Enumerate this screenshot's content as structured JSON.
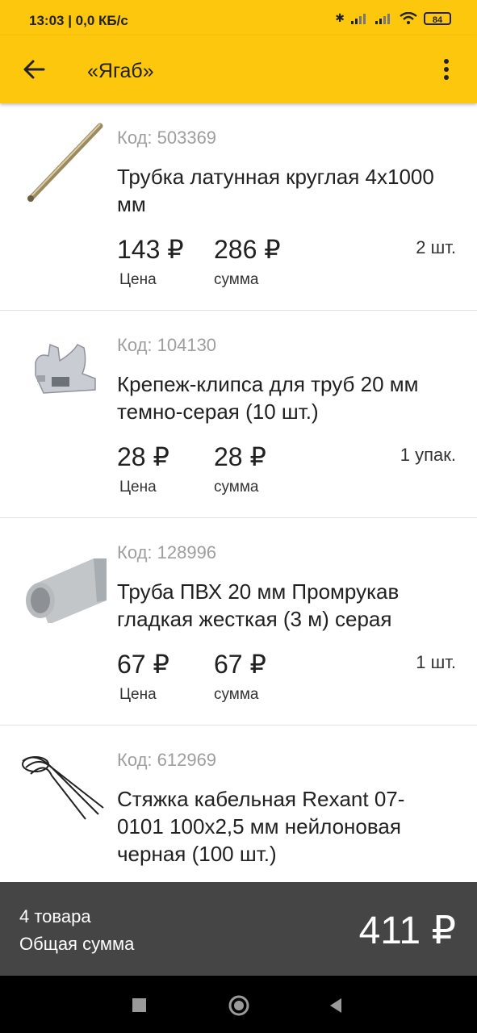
{
  "status": {
    "time": "13:03 | 0,0 КБ/с",
    "battery": "84"
  },
  "toolbar": {
    "title": "«Ягаб»"
  },
  "items": [
    {
      "code": "Код: 503369",
      "name": "Трубка латунная круглая 4х1000 мм",
      "price": "143 ₽",
      "price_label": "Цена",
      "sum": "286 ₽",
      "sum_label": "сумма",
      "qty": "2 шт."
    },
    {
      "code": "Код: 104130",
      "name": "Крепеж-клипса для труб 20 мм темно-серая (10 шт.)",
      "price": "28 ₽",
      "price_label": "Цена",
      "sum": "28 ₽",
      "sum_label": "сумма",
      "qty": "1 упак."
    },
    {
      "code": "Код: 128996",
      "name": "Труба ПВХ 20 мм Промрукав гладкая жесткая (3 м) серая",
      "price": "67 ₽",
      "price_label": "Цена",
      "sum": "67 ₽",
      "sum_label": "сумма",
      "qty": "1 шт."
    },
    {
      "code": "Код: 612969",
      "name": "Стяжка кабельная Rexant 07-0101 100х2,5 мм нейлоновая черная (100 шт.)"
    }
  ],
  "footer": {
    "count": "4 товара",
    "label": "Общая сумма",
    "total": "411 ₽"
  }
}
